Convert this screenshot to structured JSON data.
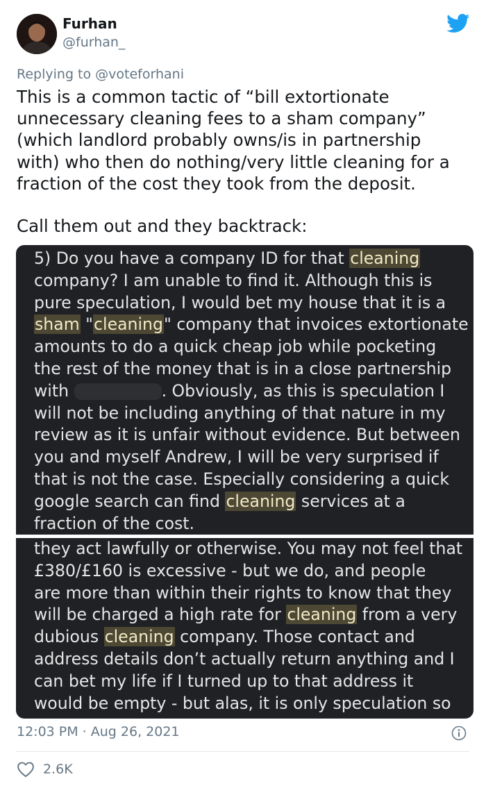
{
  "author": {
    "name": "Furhan",
    "handle": "@furhan_"
  },
  "reply": {
    "prefix": "Replying to",
    "handle": "@voteforhani"
  },
  "tweet": {
    "lines": [
      "This is a common tactic of “bill extortionate",
      "unnecessary cleaning fees to a sham company”",
      "(which landlord probably owns/is in partnership",
      "with) who then do nothing/very little cleaning for a",
      "fraction of the cost they took from the deposit."
    ],
    "line2": "Call them out and they backtrack:"
  },
  "screenshot1": {
    "l1a": "5) Do you have a company ID for that ",
    "l1h": "cleaning",
    "l2": "company? I am unable to find it. Although this is",
    "l3": "pure speculation, I would bet my house that it is a",
    "l4h1": "sham",
    "l4b": " \"",
    "l4h2": "cleaning",
    "l4c": "\" company that invoices extortionate",
    "l5": "amounts to do a quick cheap job while pocketing",
    "l6": "the rest of the money that is in a close partnership",
    "l7a": "with ",
    "l7b": ". Obviously, as this is speculation I",
    "l8": "will not be including anything of that nature in my",
    "l9": "review as it is unfair without evidence. But between",
    "l10": "you and myself Andrew, I will be very surprised if",
    "l11": "that is not the case. Especially considering a quick",
    "l12a": "google search can find ",
    "l12h": "cleaning",
    "l12b": " services at a",
    "l13": "fraction of the cost."
  },
  "screenshot2": {
    "l1": "they act lawfully or otherwise. You may not feel that",
    "l2": "£380/£160 is excessive - but we do, and people",
    "l3": "are more than within their rights to know that they",
    "l4a": "will be charged a high rate for ",
    "l4h": "cleaning",
    "l4b": " from a very",
    "l5a": "dubious ",
    "l5h": "cleaning",
    "l5b": " company. Those contact and",
    "l6": "address details don’t actually return anything and I",
    "l7": "can bet my life if I turned up to that address it",
    "l8": "would be empty - but alas, it is only speculation so"
  },
  "meta": {
    "timestamp": "12:03 PM · Aug 26, 2021"
  },
  "likes": {
    "count": "2.6K"
  },
  "colors": {
    "twitter_blue": "#1da1f2",
    "text": "#14171a",
    "secondary": "#657786",
    "screenshot_bg": "#1f2125",
    "highlight": "#4d4833"
  },
  "icons": [
    "avatar",
    "twitter-bird-icon",
    "info-icon",
    "heart-icon"
  ]
}
